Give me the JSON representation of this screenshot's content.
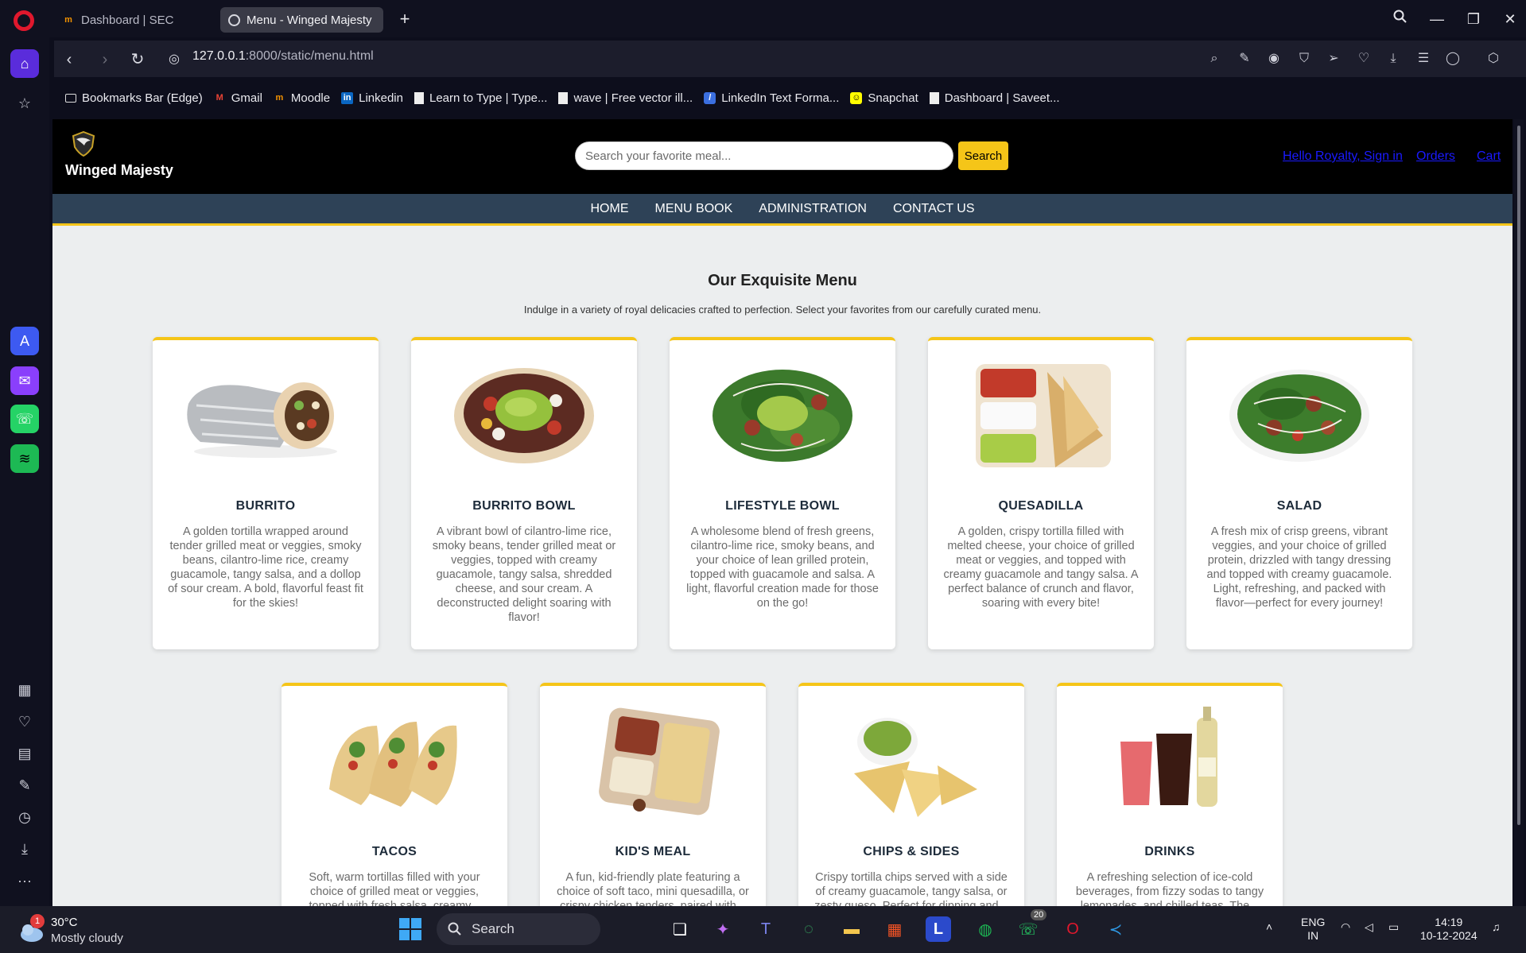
{
  "browser": {
    "tabs": [
      {
        "title": "Dashboard | SEC",
        "active": false
      },
      {
        "title": "Menu - Winged Majesty",
        "active": true
      }
    ],
    "url_host": "127.0.0.1",
    "url_path": ":8000/static/menu.html",
    "bookmarks": [
      {
        "label": "Bookmarks Bar (Edge)",
        "icon": "folder-icon"
      },
      {
        "label": "Gmail",
        "icon": "gmail-icon"
      },
      {
        "label": "Moodle",
        "icon": "moodle-icon"
      },
      {
        "label": "Linkedin",
        "icon": "linkedin-icon"
      },
      {
        "label": "Learn to Type | Type...",
        "icon": "page-icon"
      },
      {
        "label": "wave | Free vector ill...",
        "icon": "page-icon"
      },
      {
        "label": "LinkedIn Text Forma...",
        "icon": "app-icon"
      },
      {
        "label": "Snapchat",
        "icon": "snapchat-icon"
      },
      {
        "label": "Dashboard | Saveet...",
        "icon": "page-icon"
      }
    ]
  },
  "site": {
    "brand": "Winged Majesty",
    "search_placeholder": "Search your favorite meal...",
    "search_button": "Search",
    "header_links": [
      "Hello Royalty, Sign in",
      "Orders",
      "Cart"
    ],
    "nav": [
      "HOME",
      "MENU BOOK",
      "ADMINISTRATION",
      "CONTACT US"
    ],
    "colors": {
      "accent": "#f5c518",
      "nav_bg": "#2e4257",
      "header_bg": "#000000"
    }
  },
  "menu": {
    "title": "Our Exquisite Menu",
    "subtitle": "Indulge in a variety of royal delicacies crafted to perfection. Select your favorites from our carefully curated menu.",
    "items": [
      {
        "name": "BURRITO",
        "description": "A golden tortilla wrapped around tender grilled meat or veggies, smoky beans, cilantro-lime rice, creamy guacamole, tangy salsa, and a dollop of sour cream. A bold, flavorful feast fit for the skies!"
      },
      {
        "name": "BURRITO BOWL",
        "description": "A vibrant bowl of cilantro-lime rice, smoky beans, tender grilled meat or veggies, topped with creamy guacamole, tangy salsa, shredded cheese, and sour cream. A deconstructed delight soaring with flavor!"
      },
      {
        "name": "LIFESTYLE BOWL",
        "description": "A wholesome blend of fresh greens, cilantro-lime rice, smoky beans, and your choice of lean grilled protein, topped with guacamole and salsa. A light, flavorful creation made for those on the go!"
      },
      {
        "name": "QUESADILLA",
        "description": "A golden, crispy tortilla filled with melted cheese, your choice of grilled meat or veggies, and topped with creamy guacamole and tangy salsa. A perfect balance of crunch and flavor, soaring with every bite!"
      },
      {
        "name": "SALAD",
        "description": "A fresh mix of crisp greens, vibrant veggies, and your choice of grilled protein, drizzled with tangy dressing and topped with creamy guacamole. Light, refreshing, and packed with flavor—perfect for every journey!"
      },
      {
        "name": "TACOS",
        "description": "Soft, warm tortillas filled with your choice of grilled meat or veggies, topped with fresh salsa, creamy..."
      },
      {
        "name": "KID'S MEAL",
        "description": "A fun, kid-friendly plate featuring a choice of soft taco, mini quesadilla, or crispy chicken tenders, paired with..."
      },
      {
        "name": "CHIPS & SIDES",
        "description": "Crispy tortilla chips served with a side of creamy guacamole, tangy salsa, or zesty queso. Perfect for dipping and..."
      },
      {
        "name": "DRINKS",
        "description": "A refreshing selection of ice-cold beverages, from fizzy sodas to tangy lemonades, and chilled teas. The..."
      }
    ]
  },
  "taskbar": {
    "weather_temp": "30°C",
    "weather_cond": "Mostly cloudy",
    "weather_badge": "1",
    "search_label": "Search",
    "whatsapp_badge": "20",
    "lang_1": "ENG",
    "lang_2": "IN",
    "time": "14:19",
    "date": "10-12-2024"
  }
}
